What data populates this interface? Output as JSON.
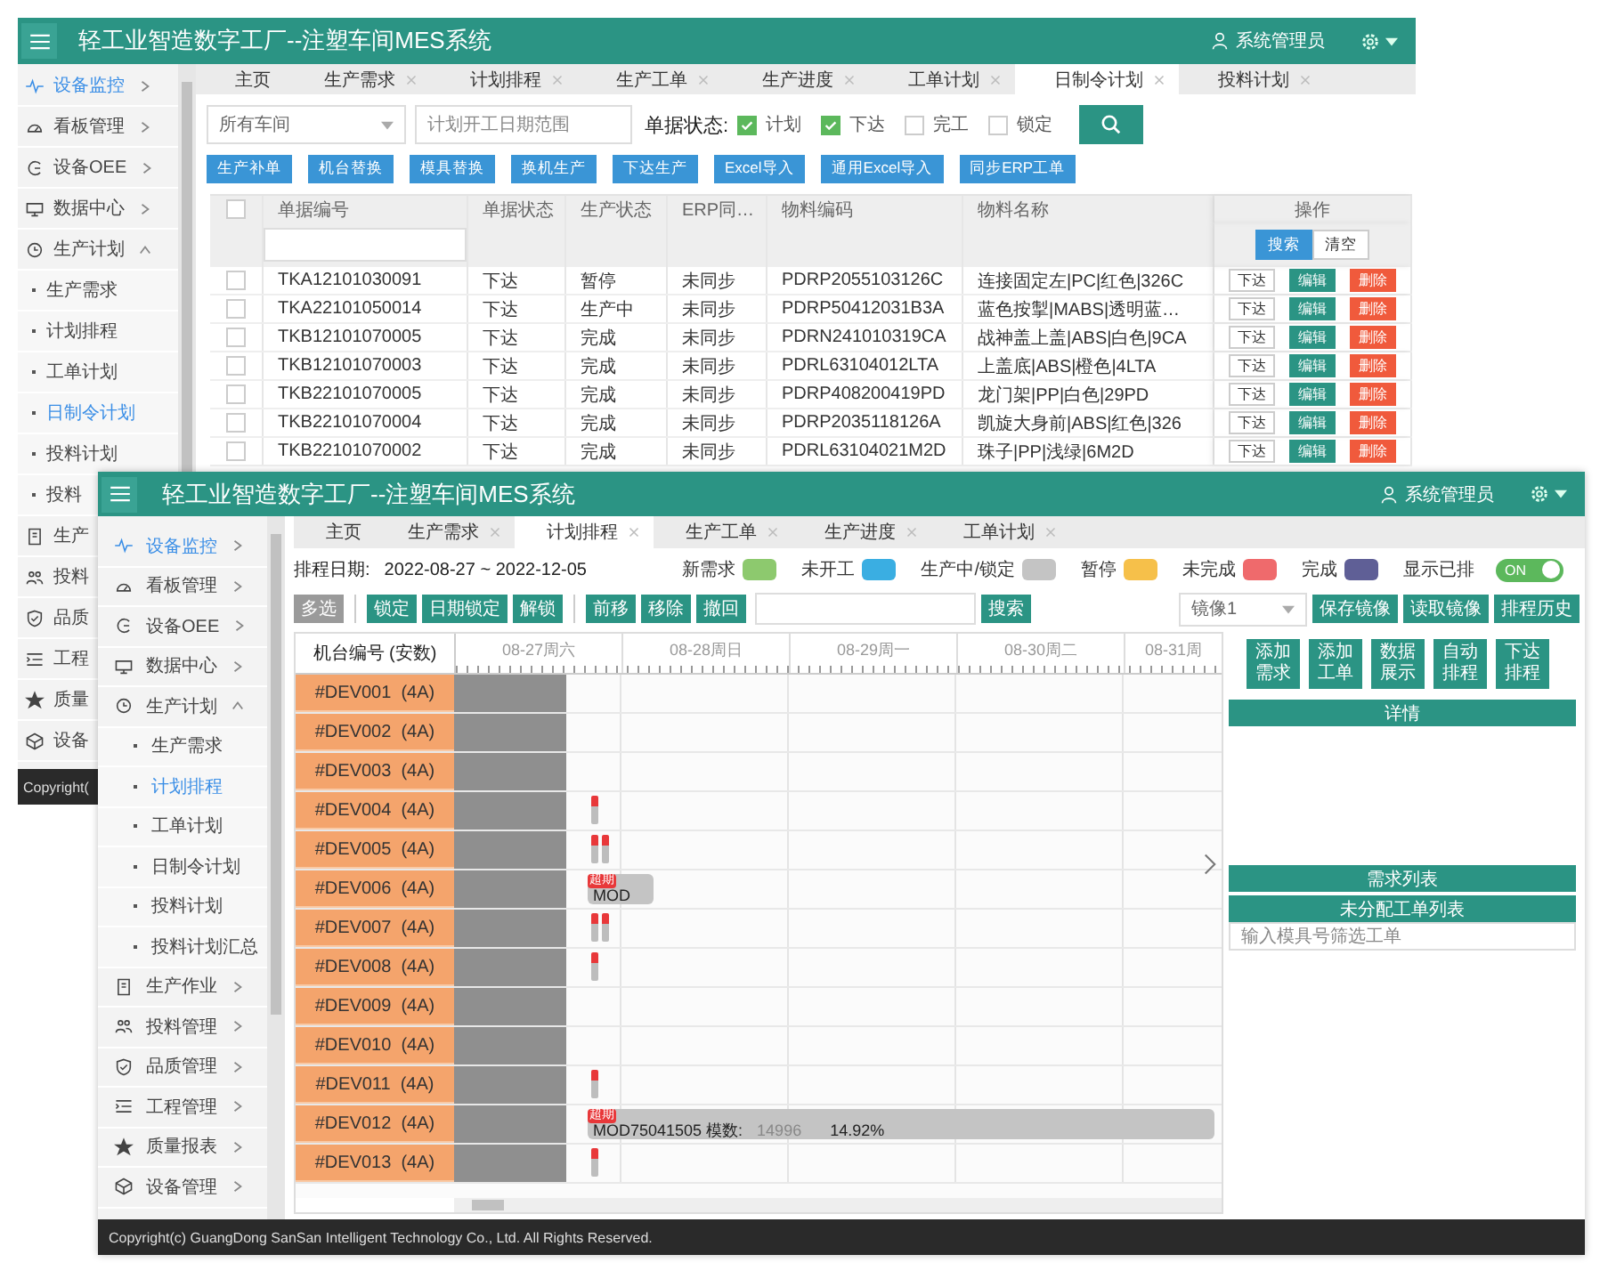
{
  "back_window": {
    "app_bar": {
      "title": "轻工业智造数字工厂--注塑车间MES系统",
      "user": "系统管理员"
    },
    "sidebar": [
      {
        "label": "设备监控",
        "selected": true,
        "expanded": false
      },
      {
        "label": "看板管理",
        "selected": false,
        "expanded": false
      },
      {
        "label": "设备OEE",
        "selected": false,
        "expanded": false
      },
      {
        "label": "数据中心",
        "selected": false,
        "expanded": false
      },
      {
        "label": "生产计划",
        "selected": false,
        "expanded": true,
        "children": [
          {
            "label": "生产需求",
            "selected": false
          },
          {
            "label": "计划排程",
            "selected": false
          },
          {
            "label": "工单计划",
            "selected": false
          },
          {
            "label": "日制令计划",
            "selected": true
          },
          {
            "label": "投料计划",
            "selected": false
          },
          {
            "label": "投料",
            "selected": false
          }
        ]
      },
      {
        "label": "生产",
        "selected": false
      },
      {
        "label": "投料",
        "selected": false
      },
      {
        "label": "品质",
        "selected": false
      },
      {
        "label": "工程",
        "selected": false
      },
      {
        "label": "质量",
        "selected": false
      },
      {
        "label": "设备",
        "selected": false
      }
    ],
    "footer": "Copyright(",
    "tabs": [
      {
        "label": "主页",
        "closable": false,
        "selected": false
      },
      {
        "label": "生产需求",
        "closable": true,
        "selected": false
      },
      {
        "label": "计划排程",
        "closable": true,
        "selected": false
      },
      {
        "label": "生产工单",
        "closable": true,
        "selected": false
      },
      {
        "label": "生产进度",
        "closable": true,
        "selected": false
      },
      {
        "label": "工单计划",
        "closable": true,
        "selected": false
      },
      {
        "label": "日制令计划",
        "closable": true,
        "selected": true
      },
      {
        "label": "投料计划",
        "closable": true,
        "selected": false
      }
    ],
    "filters": {
      "workshop": "所有车间",
      "date_range_placeholder": "计划开工日期范围",
      "status_label": "单据状态:",
      "statuses": [
        {
          "label": "计划",
          "checked": true
        },
        {
          "label": "下达",
          "checked": true
        },
        {
          "label": "完工",
          "checked": false
        },
        {
          "label": "锁定",
          "checked": false
        }
      ]
    },
    "actions": [
      "生产补单",
      "机台替换",
      "模具替换",
      "换机生产",
      "下达生产",
      "Excel导入",
      "通用Excel导入",
      "同步ERP工单"
    ],
    "table": {
      "select_all_checked": false,
      "columns": [
        "单据编号",
        "单据状态",
        "生产状态",
        "ERP同…",
        "物料编码",
        "物料名称"
      ],
      "action_column": "操作",
      "filter_buttons": [
        "搜索",
        "清空"
      ],
      "rows": [
        {
          "checked": false,
          "cells": [
            "TKA12101030091",
            "下达",
            "暂停",
            "未同步",
            "PDRP2055103126C",
            "连接固定左|PC|红色|326C"
          ],
          "actions": [
            "下达",
            "编辑",
            "删除"
          ]
        },
        {
          "checked": false,
          "cells": [
            "TKA22101050014",
            "下达",
            "生产中",
            "未同步",
            "PDRP50412031B3A",
            "蓝色按掣|MABS|透明蓝…"
          ],
          "actions": [
            "下达",
            "编辑",
            "删除"
          ]
        },
        {
          "checked": false,
          "cells": [
            "TKB12101070005",
            "下达",
            "完成",
            "未同步",
            "PDRN241010319CA",
            "战神盖上盖|ABS|白色|9CA"
          ],
          "actions": [
            "下达",
            "编辑",
            "删除"
          ]
        },
        {
          "checked": false,
          "cells": [
            "TKB12101070003",
            "下达",
            "完成",
            "未同步",
            "PDRL63104012LTA",
            "上盖底|ABS|橙色|4LTA"
          ],
          "actions": [
            "下达",
            "编辑",
            "删除"
          ]
        },
        {
          "checked": false,
          "cells": [
            "TKB22101070005",
            "下达",
            "完成",
            "未同步",
            "PDRP408200419PD",
            "龙门架|PP|白色|29PD"
          ],
          "actions": [
            "下达",
            "编辑",
            "删除"
          ]
        },
        {
          "checked": false,
          "cells": [
            "TKB22101070004",
            "下达",
            "完成",
            "未同步",
            "PDRP2035118126A",
            "凯旋大身前|ABS|红色|326"
          ],
          "actions": [
            "下达",
            "编辑",
            "删除"
          ]
        },
        {
          "checked": false,
          "cells": [
            "TKB22101070002",
            "下达",
            "完成",
            "未同步",
            "PDRL63104021M2D",
            "珠子|PP|浅绿|6M2D"
          ],
          "actions": [
            "下达",
            "编辑",
            "删除"
          ]
        }
      ]
    }
  },
  "front_window": {
    "app_bar": {
      "title": "轻工业智造数字工厂--注塑车间MES系统",
      "user": "系统管理员"
    },
    "sidebar": [
      {
        "label": "设备监控",
        "selected": true,
        "expanded": false
      },
      {
        "label": "看板管理",
        "selected": false,
        "expanded": false
      },
      {
        "label": "设备OEE",
        "selected": false,
        "expanded": false
      },
      {
        "label": "数据中心",
        "selected": false,
        "expanded": false
      },
      {
        "label": "生产计划",
        "selected": false,
        "expanded": true,
        "children": [
          {
            "label": "生产需求",
            "selected": false
          },
          {
            "label": "计划排程",
            "selected": true
          },
          {
            "label": "工单计划",
            "selected": false
          },
          {
            "label": "日制令计划",
            "selected": false
          },
          {
            "label": "投料计划",
            "selected": false
          },
          {
            "label": "投料计划汇总",
            "selected": false
          }
        ]
      },
      {
        "label": "生产作业",
        "selected": false,
        "expanded": false
      },
      {
        "label": "投料管理",
        "selected": false,
        "expanded": false
      },
      {
        "label": "品质管理",
        "selected": false,
        "expanded": false
      },
      {
        "label": "工程管理",
        "selected": false,
        "expanded": false
      },
      {
        "label": "质量报表",
        "selected": false,
        "expanded": false
      },
      {
        "label": "设备管理",
        "selected": false,
        "expanded": false
      }
    ],
    "tabs": [
      {
        "label": "主页",
        "closable": false,
        "selected": false
      },
      {
        "label": "生产需求",
        "closable": true,
        "selected": false
      },
      {
        "label": "计划排程",
        "closable": true,
        "selected": true
      },
      {
        "label": "生产工单",
        "closable": true,
        "selected": false
      },
      {
        "label": "生产进度",
        "closable": true,
        "selected": false
      },
      {
        "label": "工单计划",
        "closable": true,
        "selected": false
      }
    ],
    "schedule": {
      "date_label": "排程日期:",
      "date_range": "2022-08-27 ~ 2022-12-05",
      "legend": [
        {
          "label": "新需求",
          "color": "#8dc96e"
        },
        {
          "label": "未开工",
          "color": "#3aaee2"
        },
        {
          "label": "生产中/锁定",
          "color": "#c4c4c4"
        },
        {
          "label": "暂停",
          "color": "#f6c04a"
        },
        {
          "label": "未完成",
          "color": "#ef6a6c"
        },
        {
          "label": "完成",
          "color": "#5f5f96"
        }
      ],
      "show_scheduled": {
        "label": "显示已排",
        "on": true,
        "text": "ON"
      }
    },
    "toolbar": {
      "multi_select": {
        "label": "多选",
        "on": false
      },
      "lock_buttons": [
        "锁定",
        "日期锁定",
        "解锁"
      ],
      "move_buttons": [
        "前移",
        "移除",
        "撤回"
      ],
      "search_button": "搜索",
      "mirror": "镜像1",
      "mirror_buttons": [
        "保存镜像",
        "读取镜像",
        "排程历史"
      ]
    },
    "gantt": {
      "machine_header": "机台编号 (安数)",
      "days": [
        "08-27周六",
        "08-28周日",
        "08-29周一",
        "08-30周二",
        "08-31周"
      ],
      "machines": [
        {
          "label": "#DEV001  (4A)"
        },
        {
          "label": "#DEV002  (4A)"
        },
        {
          "label": "#DEV003  (4A)"
        },
        {
          "label": "#DEV004  (4A)",
          "tasks": [
            {
              "kind": "tick"
            }
          ]
        },
        {
          "label": "#DEV005  (4A)",
          "tasks": [
            {
              "kind": "tick"
            },
            {
              "kind": "tick"
            }
          ]
        },
        {
          "label": "#DEV006  (4A)",
          "tasks": [
            {
              "kind": "chip",
              "badge": "超期",
              "label": "MOD"
            }
          ]
        },
        {
          "label": "#DEV007  (4A)",
          "tasks": [
            {
              "kind": "tick"
            },
            {
              "kind": "tick"
            }
          ]
        },
        {
          "label": "#DEV008  (4A)",
          "tasks": [
            {
              "kind": "tick"
            }
          ]
        },
        {
          "label": "#DEV009  (4A)"
        },
        {
          "label": "#DEV010  (4A)"
        },
        {
          "label": "#DEV011  (4A)",
          "tasks": [
            {
              "kind": "tick"
            }
          ]
        },
        {
          "label": "#DEV012  (4A)",
          "tasks": [
            {
              "kind": "bar",
              "badge": "超期",
              "label": "MOD75041505 模数:",
              "count": "14996",
              "percent": "14.92%"
            }
          ]
        },
        {
          "label": "#DEV013  (4A)",
          "tasks": [
            {
              "kind": "tick"
            }
          ]
        }
      ]
    },
    "side_panel": {
      "buttons": [
        "添加需求",
        "添加工单",
        "数据展示",
        "自动排程",
        "下达排程"
      ],
      "details_title": "详情",
      "demand_title": "需求列表",
      "unassigned_title": "未分配工单列表",
      "filter_placeholder": "输入模具号筛选工单"
    },
    "footer": "Copyright(c) GuangDong SanSan Intelligent Technology Co., Ltd. All Rights Reserved."
  }
}
